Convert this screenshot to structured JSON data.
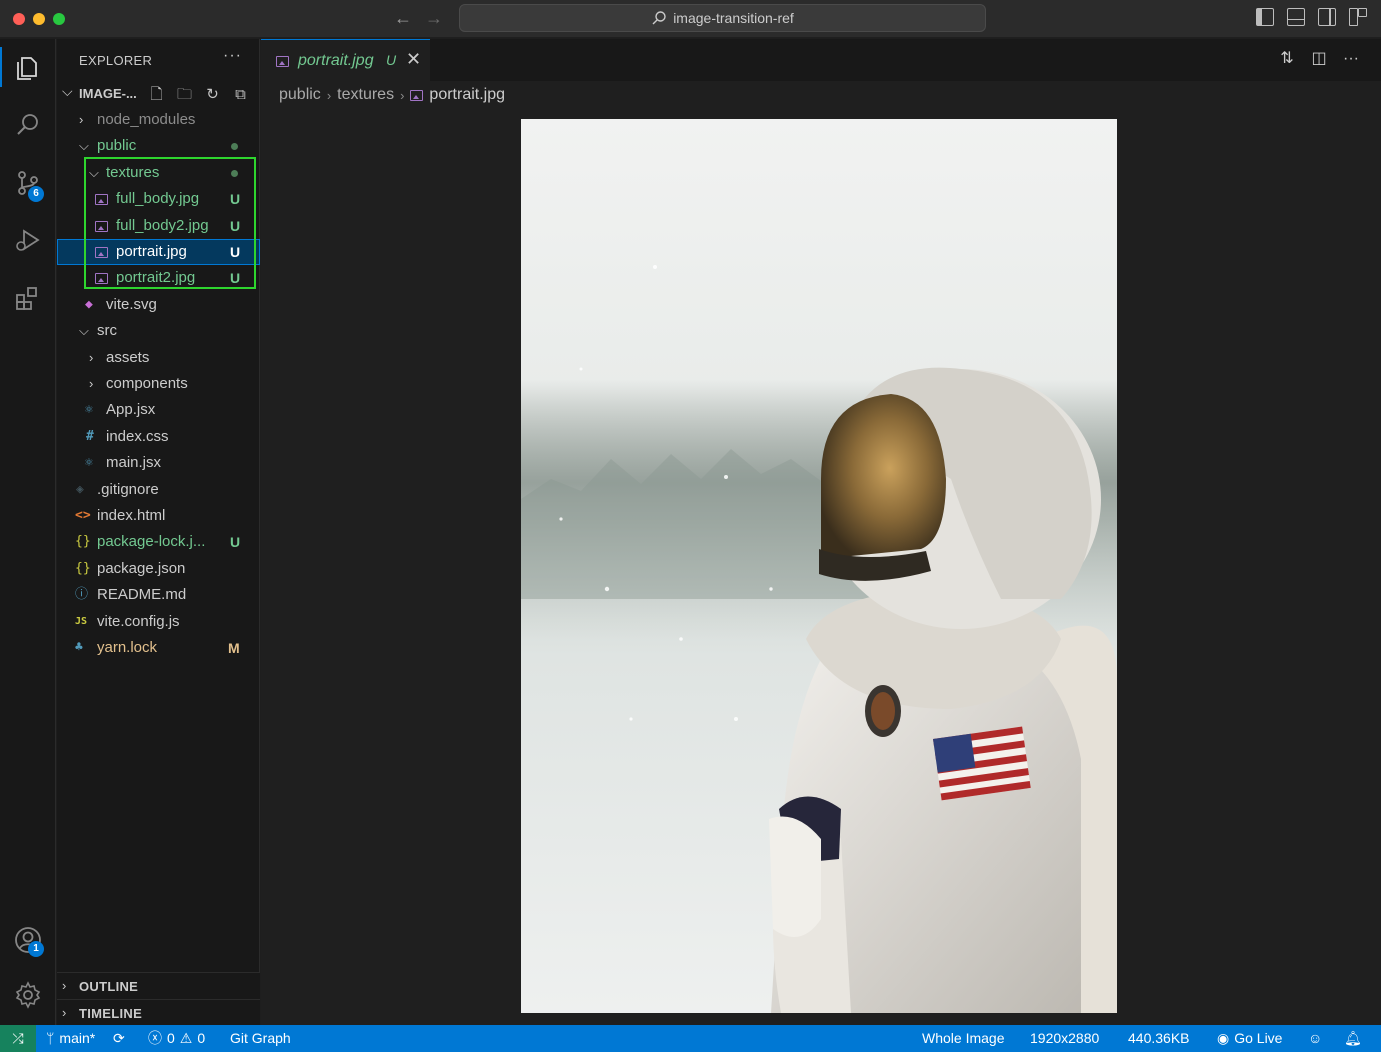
{
  "window": {
    "search_text": "image-transition-ref"
  },
  "activity_bar": {
    "source_control_badge": "6",
    "accounts_badge": "1"
  },
  "explorer": {
    "title": "EXPLORER",
    "more": "···",
    "folder_name": "IMAGE-...",
    "rows": [
      {
        "label": "node_modules",
        "deco": ""
      },
      {
        "label": "public",
        "deco": ""
      },
      {
        "label": "textures",
        "deco": ""
      },
      {
        "label": "full_body.jpg",
        "deco": "U"
      },
      {
        "label": "full_body2.jpg",
        "deco": "U"
      },
      {
        "label": "portrait.jpg",
        "deco": "U"
      },
      {
        "label": "portrait2.jpg",
        "deco": "U"
      },
      {
        "label": "vite.svg",
        "deco": ""
      },
      {
        "label": "src",
        "deco": ""
      },
      {
        "label": "assets",
        "deco": ""
      },
      {
        "label": "components",
        "deco": ""
      },
      {
        "label": "App.jsx",
        "deco": ""
      },
      {
        "label": "index.css",
        "deco": ""
      },
      {
        "label": "main.jsx",
        "deco": ""
      },
      {
        "label": ".gitignore",
        "deco": ""
      },
      {
        "label": "index.html",
        "deco": ""
      },
      {
        "label": "package-lock.j...",
        "deco": "U"
      },
      {
        "label": "package.json",
        "deco": ""
      },
      {
        "label": "README.md",
        "deco": ""
      },
      {
        "label": "vite.config.js",
        "deco": ""
      },
      {
        "label": "yarn.lock",
        "deco": "M"
      }
    ],
    "outline": "OUTLINE",
    "timeline": "TIMELINE"
  },
  "tab": {
    "label": "portrait.jpg",
    "deco": "U"
  },
  "breadcrumb": {
    "part1": "public",
    "part2": "textures",
    "part3": "portrait.jpg"
  },
  "statusbar": {
    "branch": "main*",
    "errors": "0",
    "warnings": "0",
    "git_graph": "Git Graph",
    "whole_image": "Whole Image",
    "dimensions": "1920x2880",
    "filesize": "440.36KB",
    "go_live": "Go Live"
  },
  "colors": {
    "accent": "#0078d4",
    "untracked": "#73c991",
    "modified": "#e2c08d",
    "highlight": "#2ed52e"
  }
}
